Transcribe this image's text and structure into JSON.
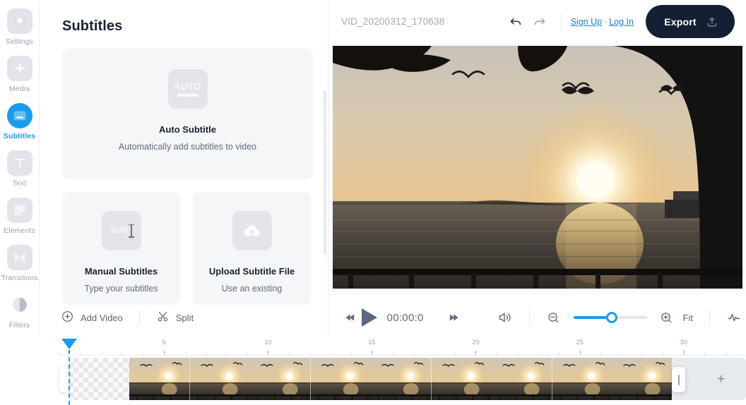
{
  "rail": {
    "items": [
      {
        "label": "Settings",
        "icon": "settings-hexagon-icon",
        "active": false
      },
      {
        "label": "Media",
        "icon": "plus-square-icon",
        "active": false
      },
      {
        "label": "Subtitles",
        "icon": "subtitles-icon",
        "active": true
      },
      {
        "label": "Text",
        "icon": "text-t-icon",
        "active": false
      },
      {
        "label": "Elements",
        "icon": "elements-shape-icon",
        "active": false
      },
      {
        "label": "Transitions",
        "icon": "transitions-bowtie-icon",
        "active": false
      },
      {
        "label": "Filters",
        "icon": "contrast-circle-icon",
        "active": false
      }
    ]
  },
  "panel": {
    "title": "Subtitles",
    "auto_card": {
      "tile_text": "AUTO",
      "name": "Auto Subtitle",
      "desc": "Automatically add subtitles to video"
    },
    "cards": [
      {
        "tile_text": "SUB",
        "name": "Manual Subtitles",
        "desc": "Type your subtitles"
      },
      {
        "tile_text": "",
        "name": "Upload Subtitle File",
        "desc": "Use an existing"
      }
    ]
  },
  "header": {
    "filename": "VID_20200312_170638",
    "undo_icon": "undo-arrow-icon",
    "redo_icon": "redo-arrow-icon",
    "sign_up": "Sign Up",
    "separator": "·",
    "log_in": "Log In",
    "export_label": "Export",
    "export_icon": "upload-icon"
  },
  "toolbar": {
    "add_video": "Add Video",
    "add_video_icon": "plus-circle-icon",
    "split": "Split",
    "split_icon": "scissors-icon",
    "skip_back_icon": "skip-backward-icon",
    "play_icon": "play-icon",
    "time": "00:00:0",
    "skip_fwd_icon": "skip-forward-icon",
    "volume_icon": "volume-icon",
    "zoom_out_icon": "zoom-out-icon",
    "zoom_in_icon": "zoom-in-icon",
    "zoom_value": 53,
    "fit": "Fit",
    "waveform_icon": "audio-waveform-icon"
  },
  "timeline": {
    "tick_labels": [
      "5",
      "10",
      "15",
      "20",
      "25",
      "30"
    ],
    "tick_positions": [
      5,
      10,
      15,
      20,
      25,
      30
    ],
    "max_seconds": 33,
    "playhead_seconds": 0,
    "add_clip_icon": "plus-icon"
  },
  "colors": {
    "accent": "#1a9bf0",
    "link": "#1a7cd8",
    "export_bg": "#151f33",
    "panel_card": "#f5f6f8",
    "muted_text": "#9aa0ac"
  }
}
